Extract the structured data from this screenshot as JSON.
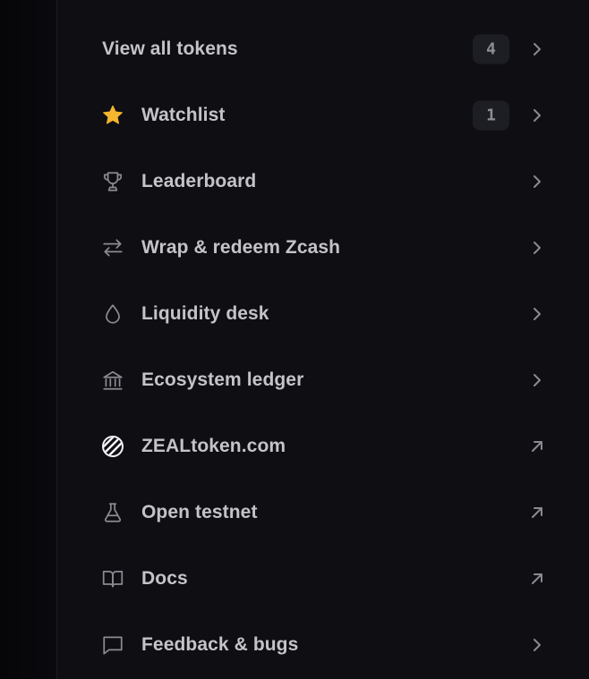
{
  "menu": {
    "items": [
      {
        "label": "View all tokens",
        "icon": "",
        "badge": "4",
        "trail_icon": "chevron-right-icon"
      },
      {
        "label": "Watchlist",
        "icon": "star-icon",
        "badge": "1",
        "trail_icon": "chevron-right-icon"
      },
      {
        "label": "Leaderboard",
        "icon": "trophy-icon",
        "badge": "",
        "trail_icon": "chevron-right-icon"
      },
      {
        "label": "Wrap & redeem Zcash",
        "icon": "swap-arrows-icon",
        "badge": "",
        "trail_icon": "chevron-right-icon"
      },
      {
        "label": "Liquidity desk",
        "icon": "droplet-icon",
        "badge": "",
        "trail_icon": "chevron-right-icon"
      },
      {
        "label": "Ecosystem ledger",
        "icon": "bank-icon",
        "badge": "",
        "trail_icon": "chevron-right-icon"
      },
      {
        "label": "ZEALtoken.com",
        "icon": "zeal-logo-icon",
        "badge": "",
        "trail_icon": "external-link-icon"
      },
      {
        "label": "Open testnet",
        "icon": "flask-icon",
        "badge": "",
        "trail_icon": "external-link-icon"
      },
      {
        "label": "Docs",
        "icon": "book-icon",
        "badge": "",
        "trail_icon": "external-link-icon"
      },
      {
        "label": "Feedback & bugs",
        "icon": "message-icon",
        "badge": "",
        "trail_icon": "chevron-right-icon"
      }
    ]
  },
  "colors": {
    "background": "#0e0e13",
    "text": "#c3c3c8",
    "icon": "#8a8a92",
    "badge_bg": "#1d1d24",
    "star": "#f5b52e"
  }
}
